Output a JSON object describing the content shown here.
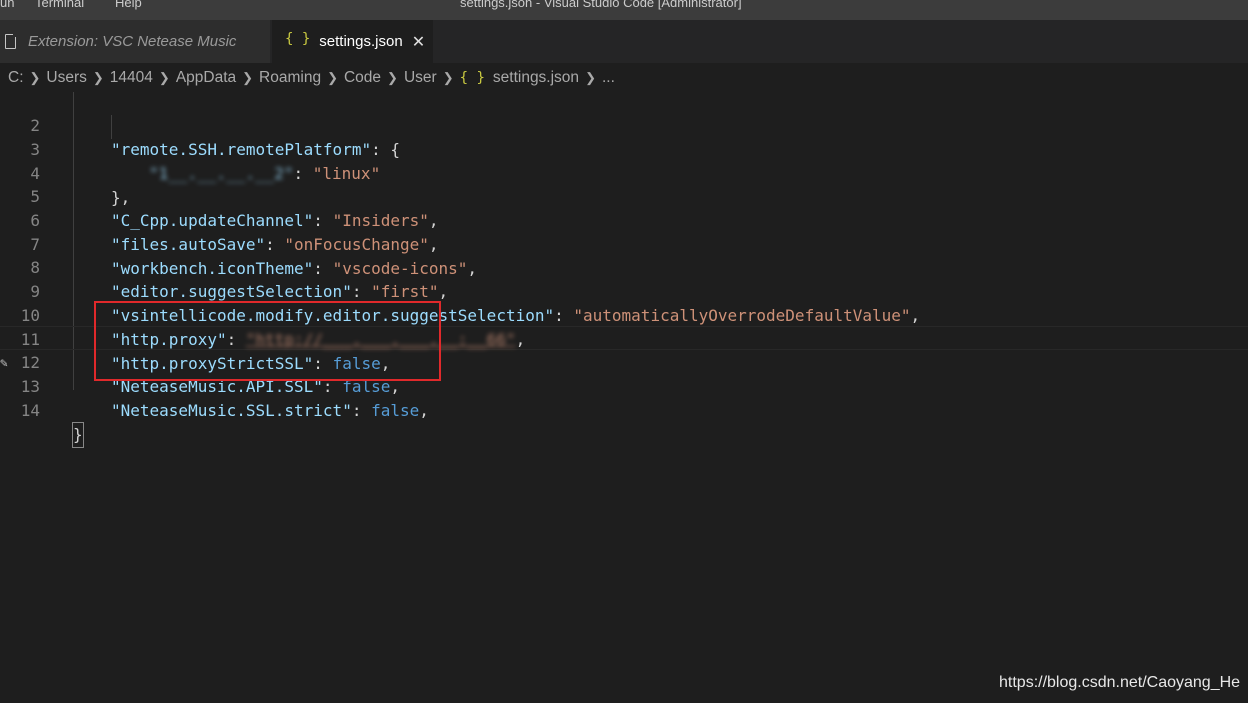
{
  "titlebar": {
    "menu": [
      "un",
      "Terminal",
      "Help"
    ],
    "window_title": "settings.json - Visual Studio Code [Administrator]"
  },
  "tabs": [
    {
      "label": "Extension: VSC Netease Music",
      "icon": "file-icon"
    },
    {
      "label": "settings.json",
      "icon": "json-braces-icon",
      "active": true
    }
  ],
  "tab_icons": {
    "json": "{ }",
    "close": "✕"
  },
  "breadcrumb": {
    "items": [
      "C:",
      "Users",
      "14404",
      "AppData",
      "Roaming",
      "Code",
      "User"
    ],
    "file": "settings.json",
    "tail": "..."
  },
  "editor": {
    "line_numbers": [
      "2",
      "3",
      "4",
      "5",
      "6",
      "7",
      "8",
      "9",
      "10",
      "11",
      "12",
      "13",
      "14"
    ],
    "lines": {
      "l2": {
        "key": "\"remote.SSH.remotePlatform\"",
        "punct": ": {"
      },
      "l3": {
        "key": "\"1__.__.__.__2\"",
        "punct": ": ",
        "value": "\"linux\""
      },
      "l4": {
        "punct": "},"
      },
      "l5": {
        "key": "\"C_Cpp.updateChannel\"",
        "punct": ": ",
        "value": "\"Insiders\"",
        "end": ","
      },
      "l6": {
        "key": "\"files.autoSave\"",
        "punct": ": ",
        "value": "\"onFocusChange\"",
        "end": ","
      },
      "l7": {
        "key": "\"workbench.iconTheme\"",
        "punct": ": ",
        "value": "\"vscode-icons\"",
        "end": ","
      },
      "l8": {
        "key": "\"editor.suggestSelection\"",
        "punct": ": ",
        "value": "\"first\"",
        "end": ","
      },
      "l9": {
        "key": "\"vsintellicode.modify.editor.suggestSelection\"",
        "punct": ": ",
        "value": "\"automaticallyOverrodeDefaultValue\"",
        "end": ","
      },
      "l10": {
        "key": "\"http.proxy\"",
        "punct": ": ",
        "value": "\"http://___.___.___.__:__66\"",
        "end": ","
      },
      "l11": {
        "key": "\"http.proxyStrictSSL\"",
        "punct": ": ",
        "value": "false",
        "end": ","
      },
      "l12": {
        "key": "\"NeteaseMusic.API.SSL\"",
        "punct": ": ",
        "value": "false",
        "end": ","
      },
      "l13": {
        "key": "\"NeteaseMusic.SSL.strict\"",
        "punct": ": ",
        "value": "false",
        "end": ","
      },
      "l14": {
        "punct": "}"
      }
    }
  },
  "colors": {
    "background": "#1e1e1e",
    "json_key": "#9cdcfe",
    "json_string": "#ce9178",
    "json_boolean": "#569cd6",
    "annotation_box": "#e0292b"
  },
  "watermark": "https://blog.csdn.net/Caoyang_He"
}
